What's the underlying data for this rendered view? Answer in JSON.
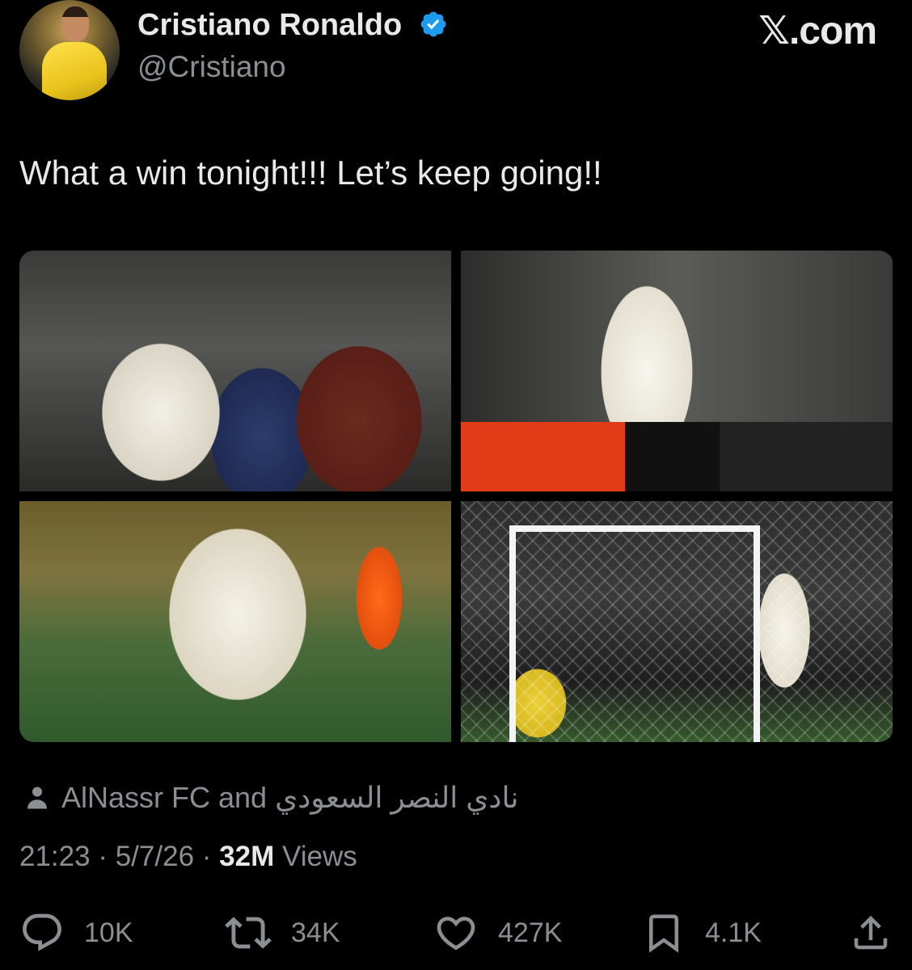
{
  "author": {
    "display_name": "Cristiano Ronaldo",
    "handle": "@Cristiano",
    "verified": true,
    "verified_color": "#1d9bf0"
  },
  "brand": "𝕏.com",
  "tweet": {
    "text": "What a win tonight!!! Let’s keep going!!"
  },
  "media": {
    "count": 4
  },
  "collaborators": {
    "text": "AlNassr FC and نادي النصر السعودي",
    "icon": "person-icon"
  },
  "meta": {
    "time": "21:23",
    "separator": "·",
    "date": "5/7/26",
    "views_count": "32M",
    "views_label": "Views"
  },
  "actions": {
    "replies": "10K",
    "reposts": "34K",
    "likes": "427K",
    "bookmarks": "4.1K"
  },
  "colors": {
    "background": "#000000",
    "primary_text": "#e7e9ea",
    "secondary_text": "#8b8f94"
  }
}
